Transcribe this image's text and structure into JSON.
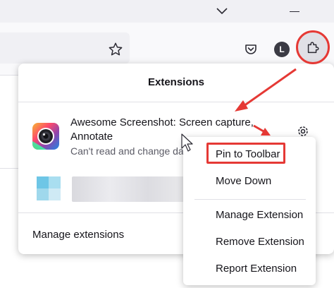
{
  "browser": {
    "account_initial": "L",
    "icons": {
      "tabs_dropdown": "chevron-down-icon",
      "minimize": "minimize-icon",
      "bookmark": "star-icon",
      "pocket": "pocket-icon",
      "extensions": "puzzle-icon"
    }
  },
  "extensions_panel": {
    "title": "Extensions",
    "items": [
      {
        "name": "Awesome Screenshot: Screen capture, Annotate",
        "description": "Can't read and change da",
        "icon": "camera-lens-icon"
      },
      {
        "name": "",
        "description": "",
        "icon": "blurred-extension-icon"
      }
    ],
    "manage_label": "Manage extensions"
  },
  "context_menu": {
    "items": [
      {
        "label": "Pin to Toolbar"
      },
      {
        "label": "Move Down"
      },
      {
        "label": "Manage Extension"
      },
      {
        "label": "Remove Extension"
      },
      {
        "label": "Report Extension"
      }
    ]
  },
  "colors": {
    "annotation_red": "#e53935",
    "toolbar_bg": "#f9f9fb",
    "titlebar_bg": "#f0f0f4",
    "text": "#15141a",
    "secondary_text": "#5b5b66"
  }
}
